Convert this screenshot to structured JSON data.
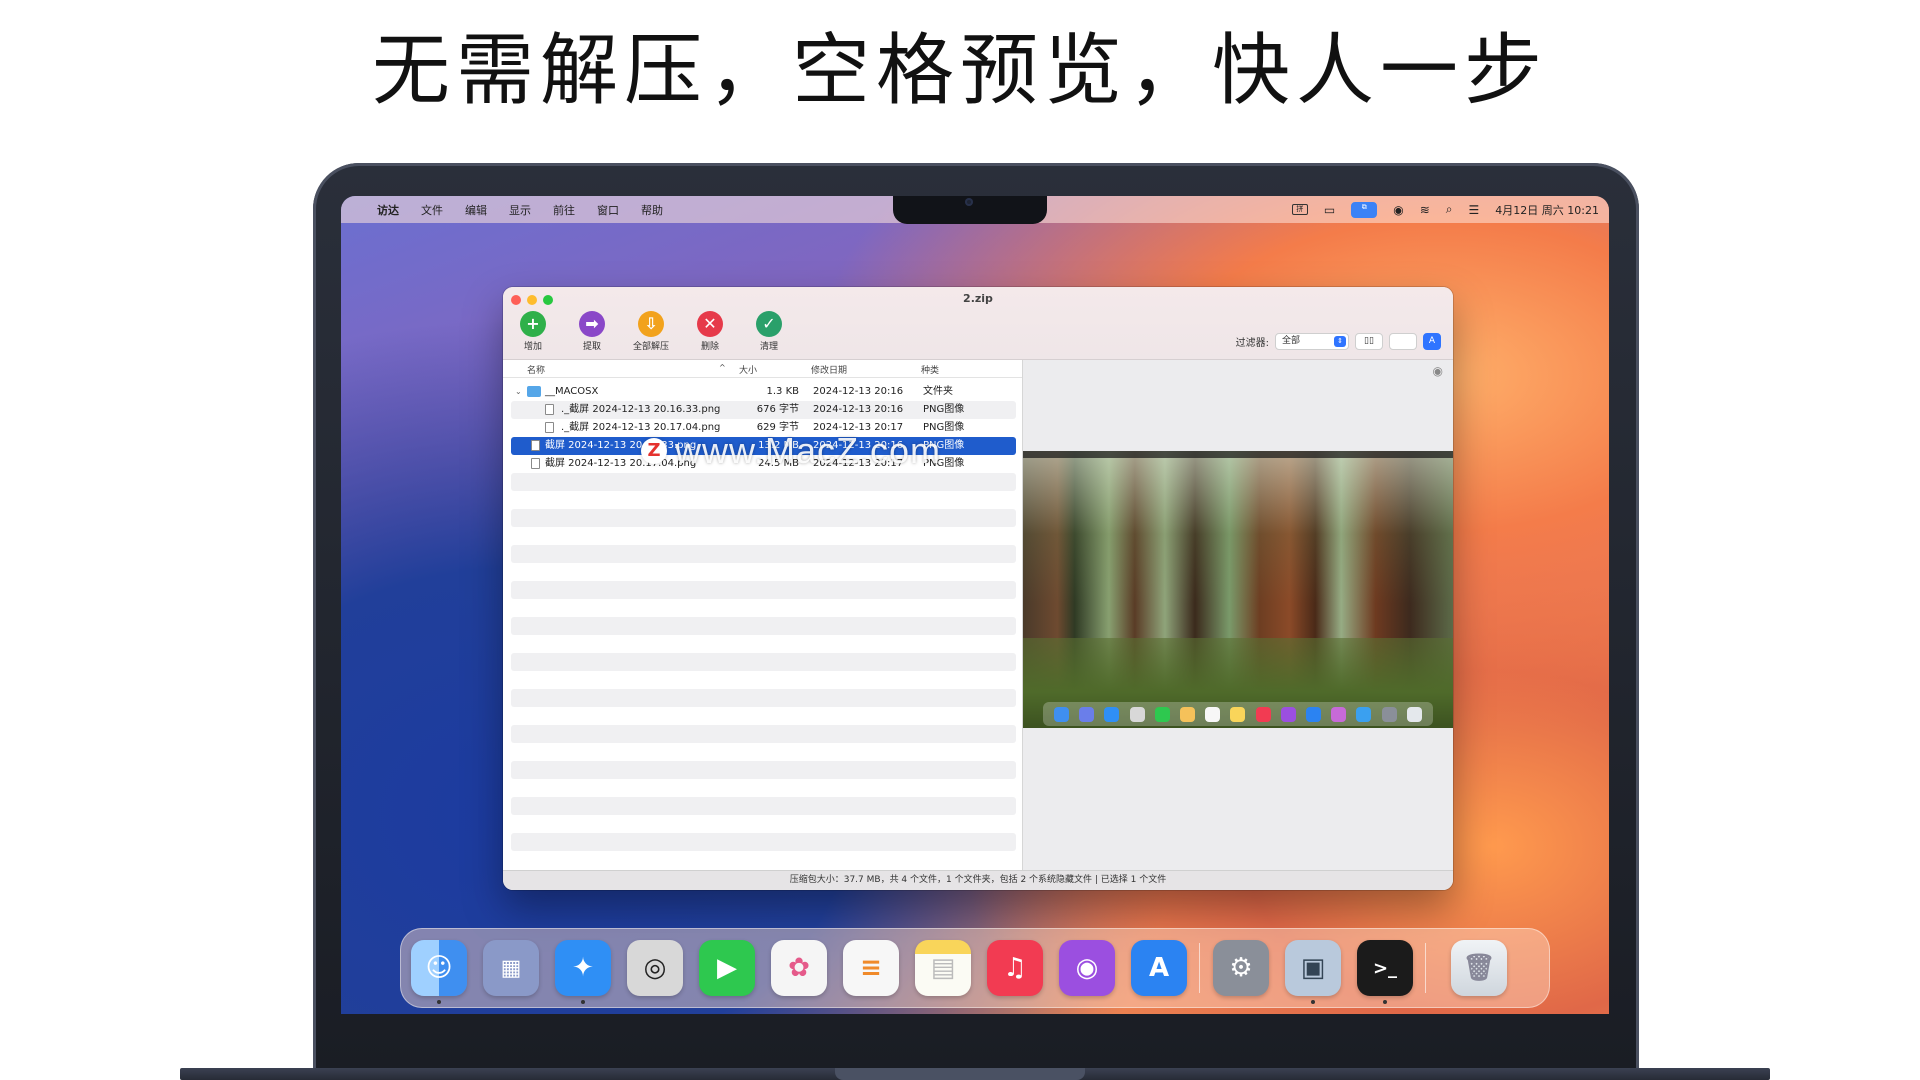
{
  "headline": "无需解压，空格预览，快人一步",
  "menubar": {
    "apple": "",
    "items": [
      "访达",
      "文件",
      "编辑",
      "显示",
      "前往",
      "窗口",
      "帮助"
    ],
    "status": {
      "input": "拼",
      "battery": "▭",
      "clock": "4月12日 周六 10:21"
    }
  },
  "window": {
    "title": "2.zip",
    "toolbar": [
      {
        "label": "增加",
        "glyph": "+",
        "color": "#2fb04a"
      },
      {
        "label": "提取",
        "glyph": "➡",
        "color": "#8a48c8"
      },
      {
        "label": "全部解压",
        "glyph": "⇩",
        "color": "#f2a21c"
      },
      {
        "label": "删除",
        "glyph": "✕",
        "color": "#e63a4a"
      },
      {
        "label": "清理",
        "glyph": "✓",
        "color": "#2aa06a"
      }
    ],
    "filter": {
      "label": "过滤器:",
      "value": "全部"
    },
    "columns": {
      "name": "名称",
      "size": "大小",
      "date": "修改日期",
      "kind": "种类"
    },
    "rows": [
      {
        "chevron": "⌄",
        "name": "__MACOSX",
        "size": "1.3 KB",
        "date": "2024-12-13 20:16",
        "kind": "文件夹"
      },
      {
        "name": "._截屏 2024-12-13 20.16.33.png",
        "size": "676 字节",
        "date": "2024-12-13 20:16",
        "kind": "PNG图像"
      },
      {
        "name": "._截屏 2024-12-13 20.17.04.png",
        "size": "629 字节",
        "date": "2024-12-13 20:17",
        "kind": "PNG图像"
      },
      {
        "name": "截屏 2024-12-13 20.16.33.png",
        "size": "13.2 MB",
        "date": "2024-12-13 20:16",
        "kind": "PNG图像"
      },
      {
        "name": "截屏 2024-12-13 20.17.04.png",
        "size": "24.5 MB",
        "date": "2024-12-13 20:17",
        "kind": "PNG图像"
      }
    ],
    "status": "压缩包大小：37.7 MB，共 4 个文件，1 个文件夹，包括 2 个系统隐藏文件 | 已选择 1 个文件"
  },
  "watermark": {
    "badge": "Z",
    "text": "www.MacZ.com"
  },
  "dock": {
    "apps": [
      {
        "name": "finder",
        "glyph": "☺",
        "color": "#3f8ff0"
      },
      {
        "name": "launchpad",
        "glyph": "▦",
        "color": "#6a7eea"
      },
      {
        "name": "safari",
        "glyph": "✦",
        "color": "#2f8ff5"
      },
      {
        "name": "screenshot",
        "glyph": "◎",
        "color": "#d8d8d8"
      },
      {
        "name": "facetime",
        "glyph": "▶",
        "color": "#2ec84f"
      },
      {
        "name": "photos",
        "glyph": "✿",
        "color": "#f5f5f5"
      },
      {
        "name": "reminders",
        "glyph": "≡",
        "color": "#f7f7f7"
      },
      {
        "name": "notes",
        "glyph": "▤",
        "color": "#f9d55a"
      },
      {
        "name": "music",
        "glyph": "♫",
        "color": "#f23b52"
      },
      {
        "name": "podcasts",
        "glyph": "◉",
        "color": "#9b4fe0"
      },
      {
        "name": "app-store",
        "glyph": "A",
        "color": "#2b83f2"
      },
      {
        "name": "system-settings",
        "glyph": "⚙",
        "color": "#8a8f99"
      },
      {
        "name": "preview",
        "glyph": "▣",
        "color": "#b9c9dc"
      },
      {
        "name": "terminal",
        "glyph": ">_",
        "color": "#1b1b1b"
      },
      {
        "name": "trash",
        "glyph": "🗑",
        "color": "#e4e8ec"
      }
    ]
  }
}
